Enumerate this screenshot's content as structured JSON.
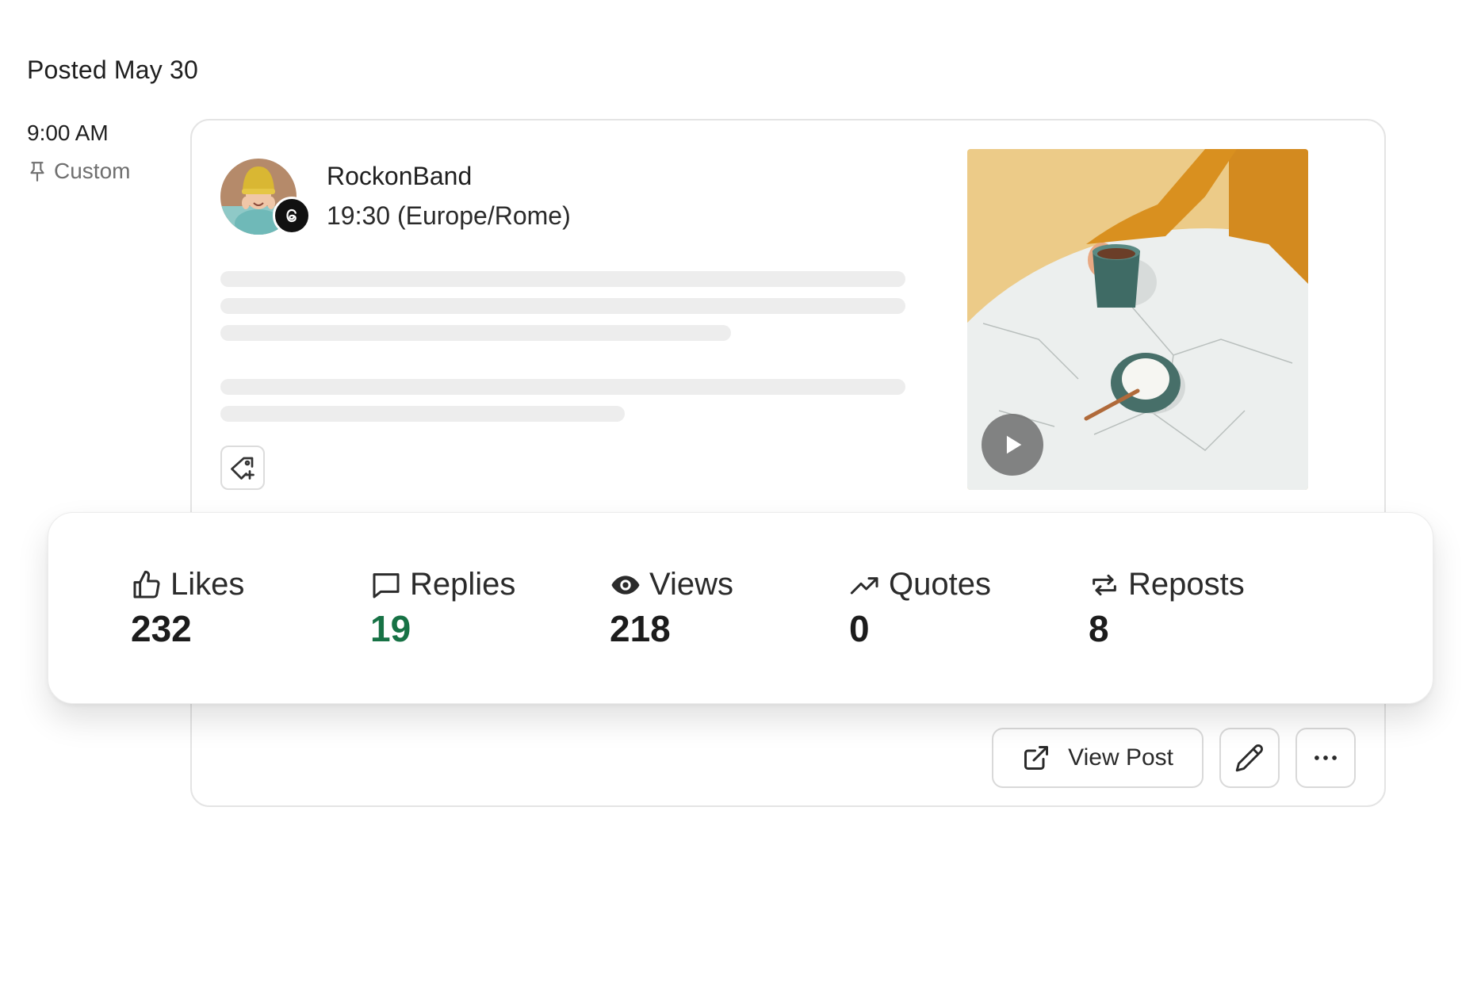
{
  "header": {
    "posted": "Posted May 30"
  },
  "schedule": {
    "time": "9:00 AM",
    "type_label": "Custom"
  },
  "post": {
    "account_name": "RockonBand",
    "account_time": "19:30 (Europe/Rome)",
    "avatar_icon": "avatar-photo",
    "platform_icon": "threads-icon",
    "media": {
      "kind": "video-thumbnail",
      "play_icon": "play-icon"
    },
    "tag_icon": "add-tag-icon"
  },
  "stats": [
    {
      "label": "Likes",
      "value": "232",
      "icon": "thumbs-up-icon"
    },
    {
      "label": "Replies",
      "value": "19",
      "icon": "comment-icon"
    },
    {
      "label": "Views",
      "value": "218",
      "icon": "eye-icon"
    },
    {
      "label": "Quotes",
      "value": "0",
      "icon": "trending-up-icon"
    },
    {
      "label": "Reposts",
      "value": "8",
      "icon": "repost-icon"
    }
  ],
  "actions": {
    "view_post_label": "View Post",
    "view_post_icon": "external-link-icon",
    "edit_icon": "pencil-icon",
    "more_icon": "more-horizontal-icon"
  },
  "colors": {
    "accent_green": "#177245",
    "skeleton": "#ededed",
    "border": "#e4e4e4"
  }
}
